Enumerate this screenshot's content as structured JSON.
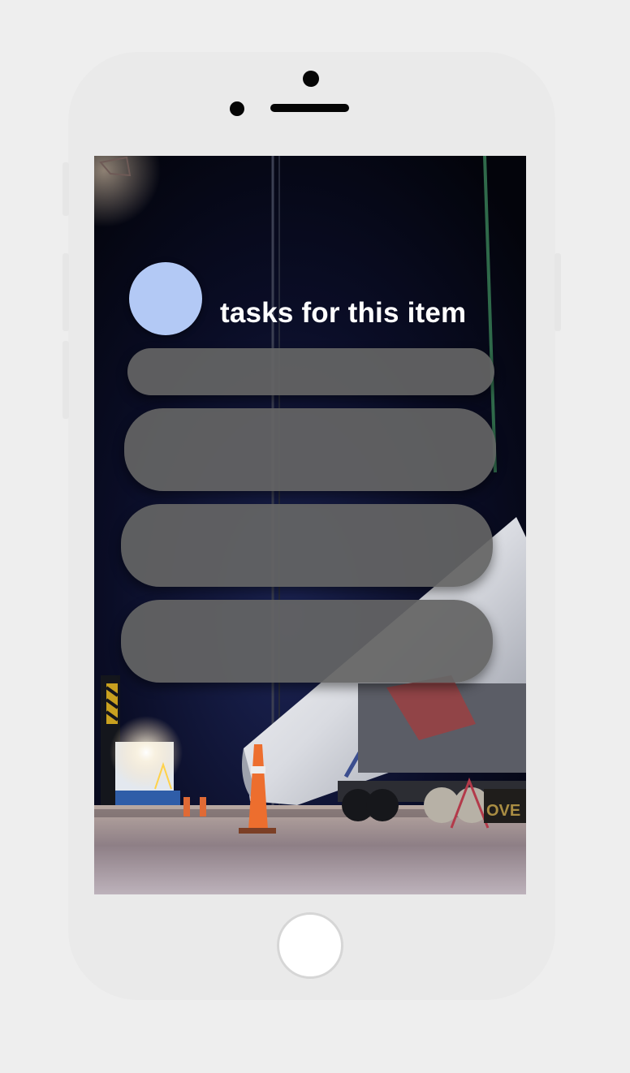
{
  "header": {
    "title": "tasks for this item"
  },
  "colors": {
    "avatar": "#b3c9f5",
    "task_card": "#646464",
    "page_background": "#eeeeee",
    "phone_body": "#eaeaea"
  },
  "tasks": [
    {
      "label": ""
    },
    {
      "label": ""
    },
    {
      "label": ""
    },
    {
      "label": ""
    }
  ],
  "device": {
    "home_button_icon": "home-button-circle"
  }
}
